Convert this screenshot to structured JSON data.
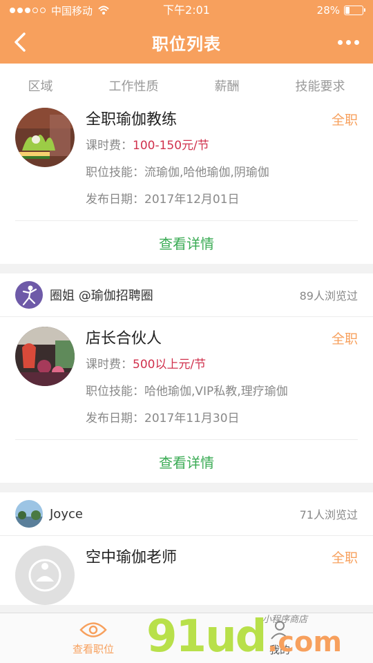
{
  "status_bar": {
    "carrier": "中国移动",
    "time": "下午2:01",
    "battery": "28%"
  },
  "header": {
    "title": "职位列表"
  },
  "filters": [
    "区域",
    "工作性质",
    "薪酬",
    "技能要求"
  ],
  "jobs": [
    {
      "title": "全职瑜伽教练",
      "type": "全职",
      "fee_label": "课时费：",
      "fee_value": "100-150元/节",
      "skills_label": "职位技能：",
      "skills_value": "流瑜伽,哈他瑜伽,阴瑜伽",
      "date_label": "发布日期：",
      "date_value": "2017年12月01日",
      "detail_label": "查看详情"
    },
    {
      "poster": "圈姐 @瑜伽招聘圈",
      "views": "89人浏览过",
      "title": "店长合伙人",
      "type": "全职",
      "fee_label": "课时费：",
      "fee_value": "500以上元/节",
      "skills_label": "职位技能：",
      "skills_value": "哈他瑜伽,VIP私教,理疗瑜伽",
      "date_label": "发布日期：",
      "date_value": "2017年11月30日",
      "detail_label": "查看详情"
    },
    {
      "poster": "Joyce",
      "views": "71人浏览过",
      "title": "空中瑜伽老师",
      "type": "全职"
    }
  ],
  "tabbar": {
    "tab1": "查看职位",
    "tab2": "我的"
  },
  "watermark": {
    "main": "91ud",
    "com": ".com",
    "sub": "小程序商店"
  },
  "colors": {
    "accent": "#f7a05d",
    "salary": "#d0304c",
    "detail": "#3aab54"
  }
}
